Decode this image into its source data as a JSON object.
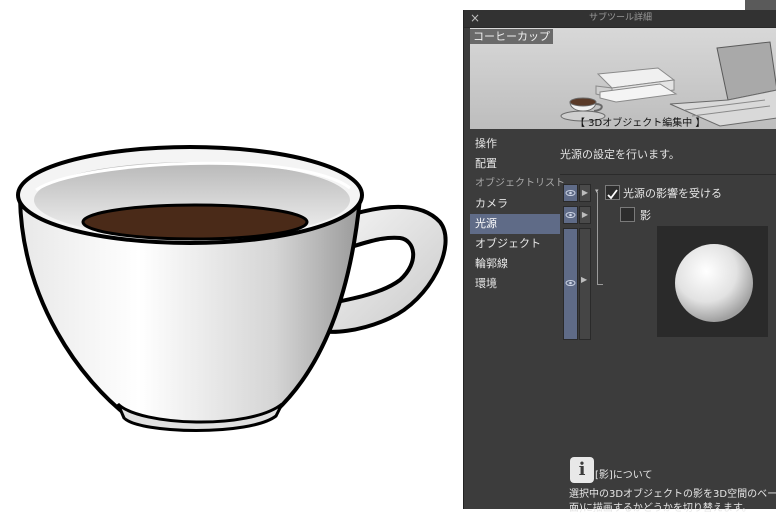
{
  "panel": {
    "title": "サブツール詳細",
    "close_icon": "close-icon",
    "preview": {
      "label": "コーヒーカップ",
      "status": "【 3Dオブジェクト編集中 】"
    },
    "nav": [
      {
        "label": "操作"
      },
      {
        "label": "配置"
      },
      {
        "label": "オブジェクトリスト"
      },
      {
        "label": "カメラ"
      },
      {
        "label": "光源"
      },
      {
        "label": "オブジェクト"
      },
      {
        "label": "輪郭線"
      },
      {
        "label": "環境"
      }
    ],
    "active_nav": "光源",
    "description": "光源の設定を行います。",
    "options": {
      "light_affect": {
        "label": "光源の影響を受ける",
        "checked": true
      },
      "shadow": {
        "label": "影",
        "checked": false
      }
    },
    "info": {
      "title": "[影]について",
      "text_line1": "選択中の3Dオブジェクトの影を3D空間のベー",
      "text_line2": "面)に描画するかどうかを切り替えます。"
    }
  },
  "colors": {
    "accent": "#5f6b87",
    "panel_bg": "#3c3c3c",
    "coffee": "#4a2a18"
  }
}
